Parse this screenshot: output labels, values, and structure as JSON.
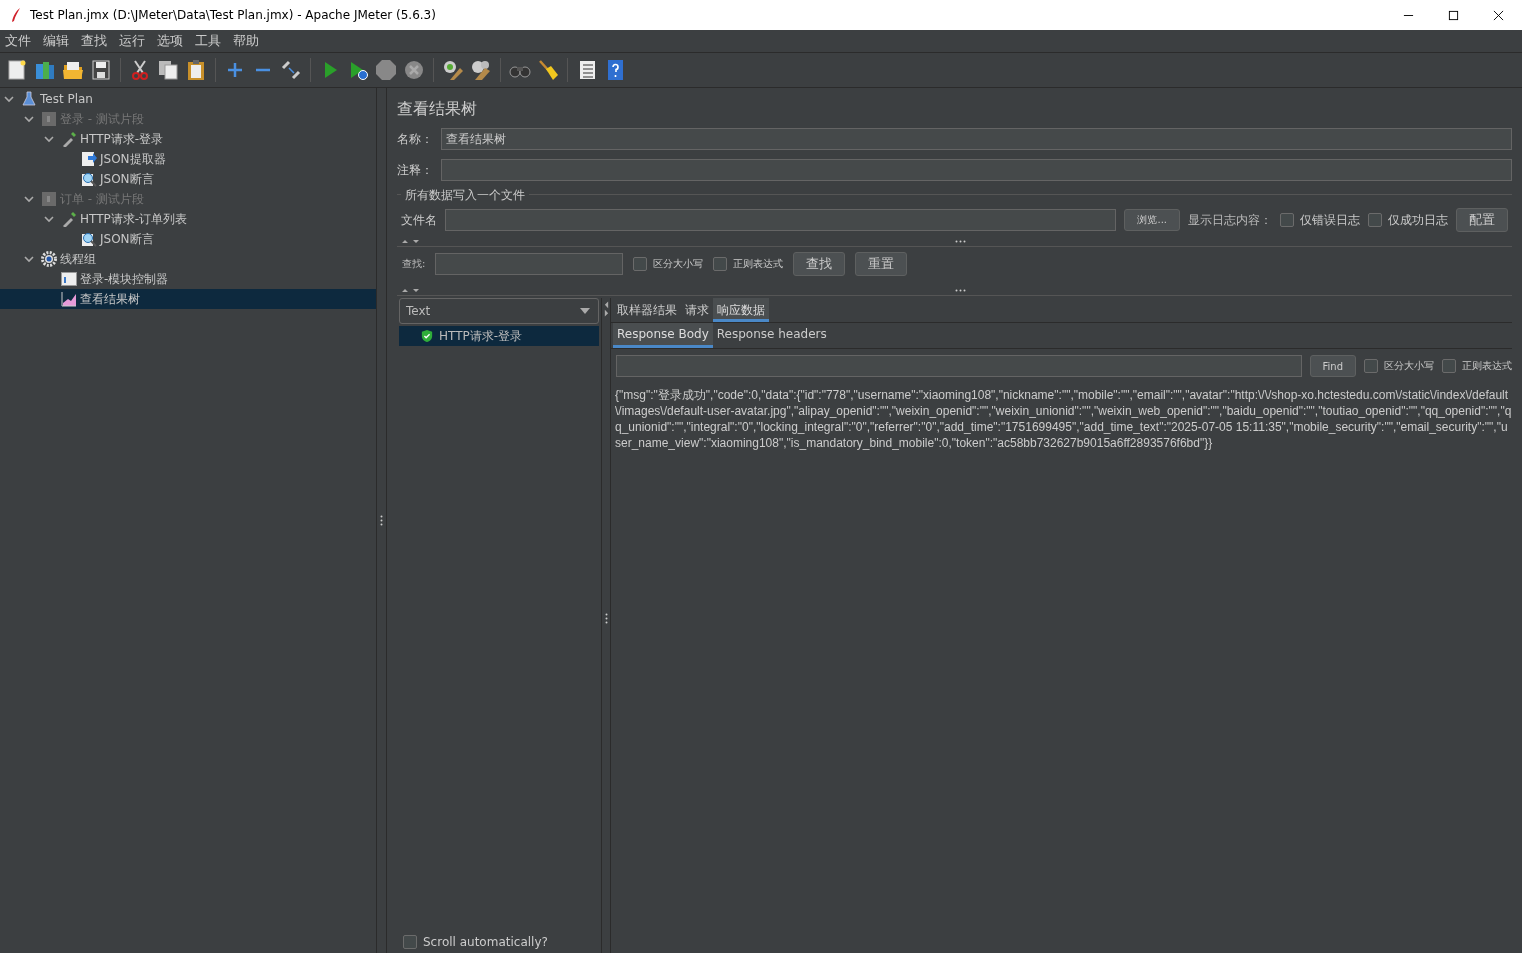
{
  "window": {
    "title": "Test Plan.jmx (D:\\JMeter\\Data\\Test Plan.jmx) - Apache JMeter (5.6.3)"
  },
  "menu": [
    "文件",
    "编辑",
    "查找",
    "运行",
    "选项",
    "工具",
    "帮助"
  ],
  "tree": [
    {
      "label": "Test Plan",
      "kind": "plan",
      "expanded": true,
      "disabled": false,
      "selected": false,
      "children": [
        {
          "label": "登录 - 测试片段",
          "kind": "fragment",
          "expanded": true,
          "disabled": true,
          "selected": false,
          "children": [
            {
              "label": "HTTP请求-登录",
              "kind": "sampler",
              "expanded": true,
              "disabled": false,
              "selected": false,
              "children": [
                {
                  "label": "JSON提取器",
                  "kind": "extractor",
                  "disabled": false,
                  "selected": false
                },
                {
                  "label": "JSON断言",
                  "kind": "assertion",
                  "disabled": false,
                  "selected": false
                }
              ]
            }
          ]
        },
        {
          "label": "订单 - 测试片段",
          "kind": "fragment",
          "expanded": true,
          "disabled": true,
          "selected": false,
          "children": [
            {
              "label": "HTTP请求-订单列表",
              "kind": "sampler",
              "expanded": true,
              "disabled": false,
              "selected": false,
              "children": [
                {
                  "label": "JSON断言",
                  "kind": "assertion",
                  "disabled": false,
                  "selected": false
                }
              ]
            }
          ]
        },
        {
          "label": "线程组",
          "kind": "threadgroup",
          "expanded": true,
          "disabled": false,
          "selected": false,
          "children": [
            {
              "label": "登录-模块控制器",
              "kind": "controller",
              "disabled": false,
              "selected": false
            },
            {
              "label": "查看结果树",
              "kind": "listener",
              "disabled": false,
              "selected": true
            }
          ]
        }
      ]
    }
  ],
  "panel": {
    "title": "查看结果树",
    "name_label": "名称：",
    "name_value": "查看结果树",
    "comment_label": "注释：",
    "file_section": "所有数据写入一个文件",
    "file_label": "文件名",
    "browse": "浏览...",
    "log_label": "显示日志内容：",
    "log_options": [
      {
        "label": "仅错误日志",
        "checked": false
      },
      {
        "label": "仅成功日志",
        "checked": false
      }
    ],
    "config": "配置"
  },
  "search": {
    "label": "查找:",
    "options": [
      {
        "label": "区分大小写",
        "checked": false
      },
      {
        "label": "正则表达式",
        "checked": false
      }
    ],
    "buttons": [
      "查找",
      "重置"
    ]
  },
  "renderer": {
    "value": "Text"
  },
  "results": [
    {
      "label": "HTTP请求-登录",
      "success": true,
      "selected": true
    }
  ],
  "tabs": [
    {
      "label": "取样器结果",
      "selected": false
    },
    {
      "label": "请求",
      "selected": false
    },
    {
      "label": "响应数据",
      "selected": true
    }
  ],
  "subtabs": [
    {
      "label": "Response Body",
      "selected": true
    },
    {
      "label": "Response headers",
      "selected": false
    }
  ],
  "find": {
    "button": "Find",
    "options": [
      {
        "label": "区分大小写",
        "checked": false
      },
      {
        "label": "正则表达式",
        "checked": false
      }
    ]
  },
  "response_body": "{\"msg\":\"登录成功\",\"code\":0,\"data\":{\"id\":\"778\",\"username\":\"xiaoming108\",\"nickname\":\"\",\"mobile\":\"\",\"email\":\"\",\"avatar\":\"http:\\/\\/shop-xo.hctestedu.com\\/static\\/index\\/default\\/images\\/default-user-avatar.jpg\",\"alipay_openid\":\"\",\"weixin_openid\":\"\",\"weixin_unionid\":\"\",\"weixin_web_openid\":\"\",\"baidu_openid\":\"\",\"toutiao_openid\":\"\",\"qq_openid\":\"\",\"qq_unionid\":\"\",\"integral\":\"0\",\"locking_integral\":\"0\",\"referrer\":\"0\",\"add_time\":\"1751699495\",\"add_time_text\":\"2025-07-05 15:11:35\",\"mobile_security\":\"\",\"email_security\":\"\",\"user_name_view\":\"xiaoming108\",\"is_mandatory_bind_mobile\":0,\"token\":\"ac58bb732627b9015a6ff2893576f6bd\"}}",
  "scroll": {
    "label": "Scroll automatically?",
    "checked": false
  }
}
